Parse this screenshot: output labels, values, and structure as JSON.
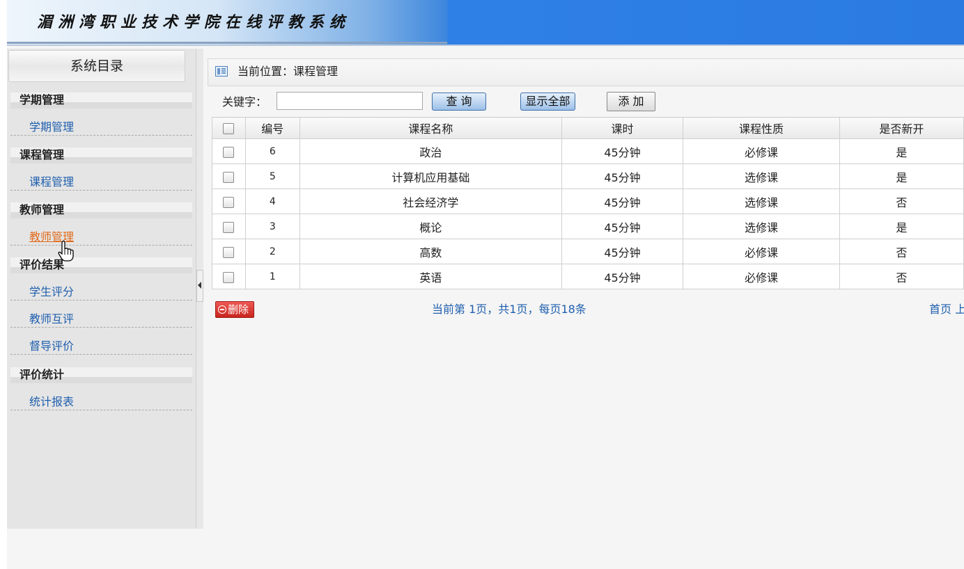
{
  "header": {
    "title": "湄洲湾职业技术学院在线评教系统"
  },
  "sidebar": {
    "title": "系统目录",
    "sections": [
      {
        "label": "学期管理",
        "items": [
          {
            "label": "学期管理"
          }
        ]
      },
      {
        "label": "课程管理",
        "items": [
          {
            "label": "课程管理"
          }
        ]
      },
      {
        "label": "教师管理",
        "items": [
          {
            "label": "教师管理"
          }
        ]
      },
      {
        "label": "评价结果",
        "items": [
          {
            "label": "学生评分"
          },
          {
            "label": "教师互评"
          },
          {
            "label": "督导评价"
          }
        ]
      },
      {
        "label": "评价统计",
        "items": [
          {
            "label": "统计报表"
          }
        ]
      }
    ]
  },
  "breadcrumb": {
    "label": "当前位置：课程管理"
  },
  "search": {
    "label": "关键字：",
    "value": "",
    "query_button": "查 询",
    "show_all_button": "显示全部",
    "add_button": "添 加"
  },
  "table": {
    "headers": [
      "编号",
      "课程名称",
      "课时",
      "课程性质",
      "是否新开"
    ],
    "rows": [
      {
        "id": "6",
        "name": "政治",
        "hours": "45分钟",
        "type": "必修课",
        "is_new": "是"
      },
      {
        "id": "5",
        "name": "计算机应用基础",
        "hours": "45分钟",
        "type": "选修课",
        "is_new": "是"
      },
      {
        "id": "4",
        "name": "社会经济学",
        "hours": "45分钟",
        "type": "选修课",
        "is_new": "否"
      },
      {
        "id": "3",
        "name": "概论",
        "hours": "45分钟",
        "type": "选修课",
        "is_new": "是"
      },
      {
        "id": "2",
        "name": "高数",
        "hours": "45分钟",
        "type": "必修课",
        "is_new": "否"
      },
      {
        "id": "1",
        "name": "英语",
        "hours": "45分钟",
        "type": "必修课",
        "is_new": "否"
      }
    ]
  },
  "footer": {
    "delete_button": "删除",
    "pager_text": "当前第 1页，共1页，每页18条",
    "first_page": "首页",
    "prev_page_partial": "上"
  }
}
